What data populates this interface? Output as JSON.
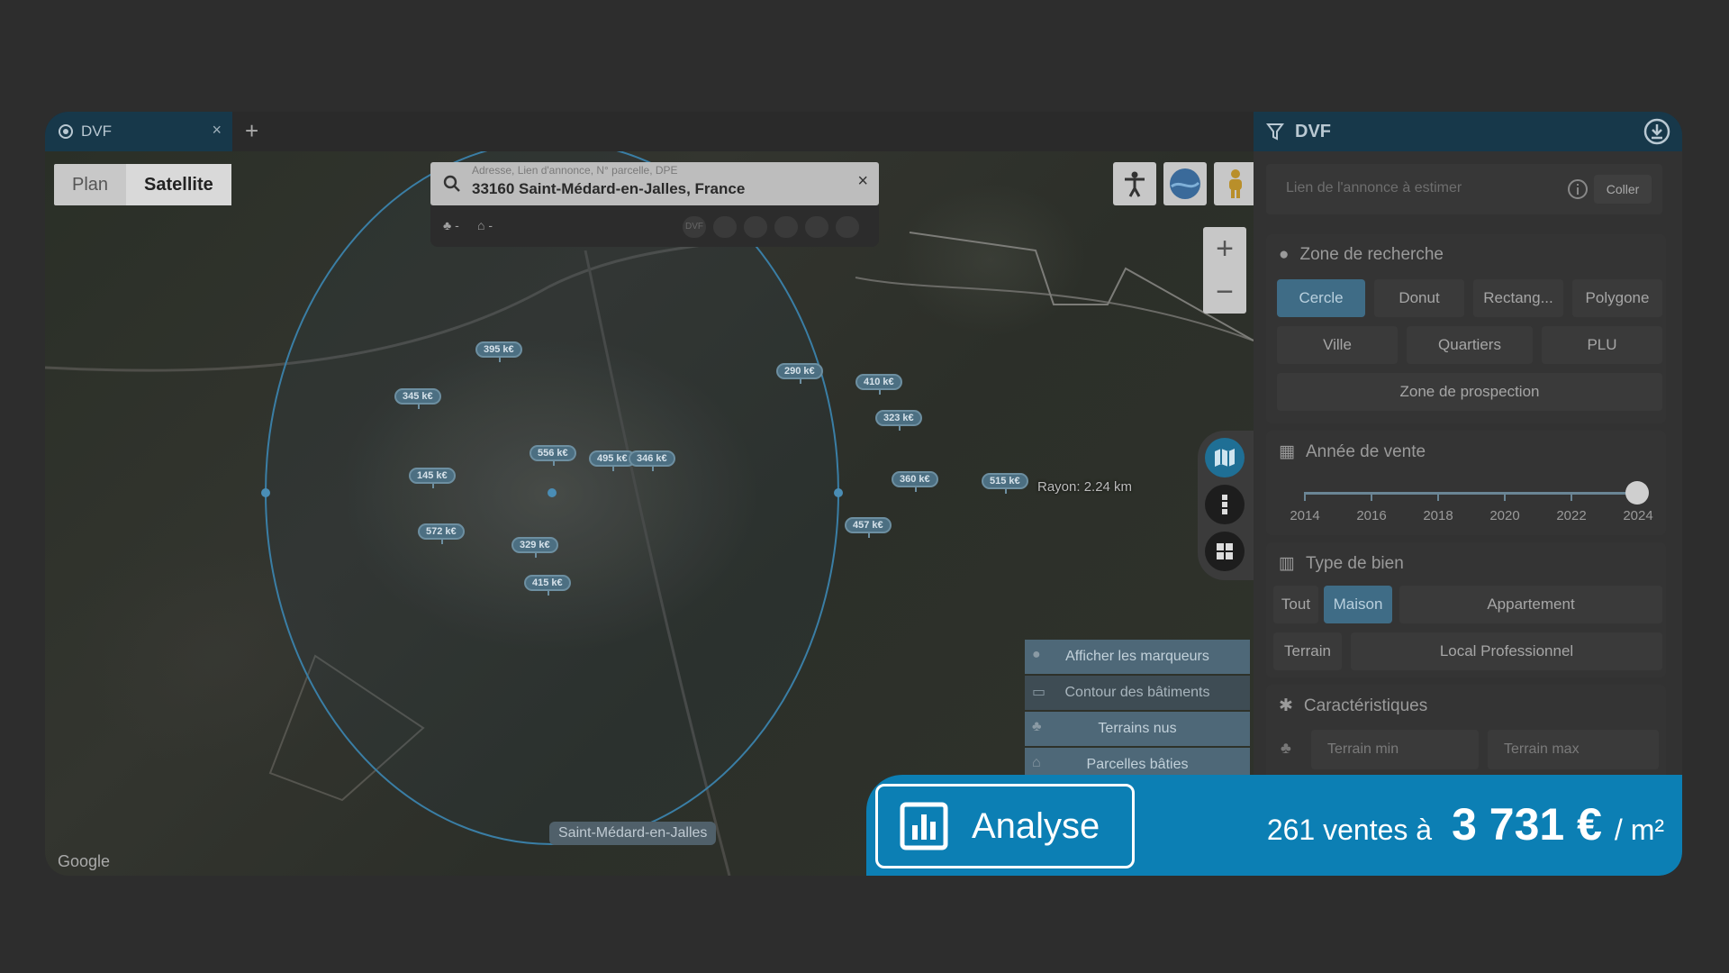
{
  "tab": {
    "title": "DVF",
    "close": "×",
    "add": "+"
  },
  "map": {
    "type_plan": "Plan",
    "type_satellite": "Satellite",
    "search_placeholder": "Adresse, Lien d'annonce, N° parcelle, DPE",
    "search_value": "33160 Saint-Médard-en-Jalles, France",
    "search_clear": "×",
    "filter1": "-",
    "filter2": "-",
    "subicon_dvf": "DVF",
    "zoom_in": "+",
    "zoom_out": "−",
    "rayon": "Rayon: 2.24 km",
    "city_label": "Saint-Médard-en-Jalles",
    "google": "Google",
    "markers": [
      "395 k€",
      "345 k€",
      "290 k€",
      "410 k€",
      "323 k€",
      "556 k€",
      "495 k€",
      "346 k€",
      "145 k€",
      "360 k€",
      "515 k€",
      "572 k€",
      "329 k€",
      "457 k€",
      "415 k€"
    ],
    "layers": [
      "Afficher les marqueurs",
      "Contour des bâtiments",
      "Terrains nus",
      "Parcelles bâties"
    ]
  },
  "panel": {
    "title": "DVF",
    "link_placeholder": "Lien de l'annonce à estimer",
    "coller": "Coller",
    "zone": {
      "title": "Zone de recherche",
      "row1": [
        "Cercle",
        "Donut",
        "Rectang...",
        "Polygone"
      ],
      "row2": [
        "Ville",
        "Quartiers",
        "PLU"
      ],
      "prospection": "Zone de prospection",
      "selected": "Cercle"
    },
    "annee": {
      "title": "Année de vente",
      "years": [
        "2014",
        "2016",
        "2018",
        "2020",
        "2022",
        "2024"
      ],
      "selected": "2024"
    },
    "type": {
      "title": "Type de bien",
      "row1": [
        "Tout",
        "Maison",
        "Appartement"
      ],
      "row2": [
        "Terrain",
        "Local Professionnel"
      ],
      "selected": "Maison"
    },
    "carac": {
      "title": "Caractéristiques",
      "terrain_min": "Terrain min",
      "terrain_max": "Terrain max"
    }
  },
  "banner": {
    "analyse": "Analyse",
    "count": "261 ventes à",
    "price": "3 731 €",
    "unit": "/ m²"
  },
  "colors": {
    "accent": "#0c7fb4",
    "tab": "#17384a",
    "marker": "#4c6f82"
  }
}
